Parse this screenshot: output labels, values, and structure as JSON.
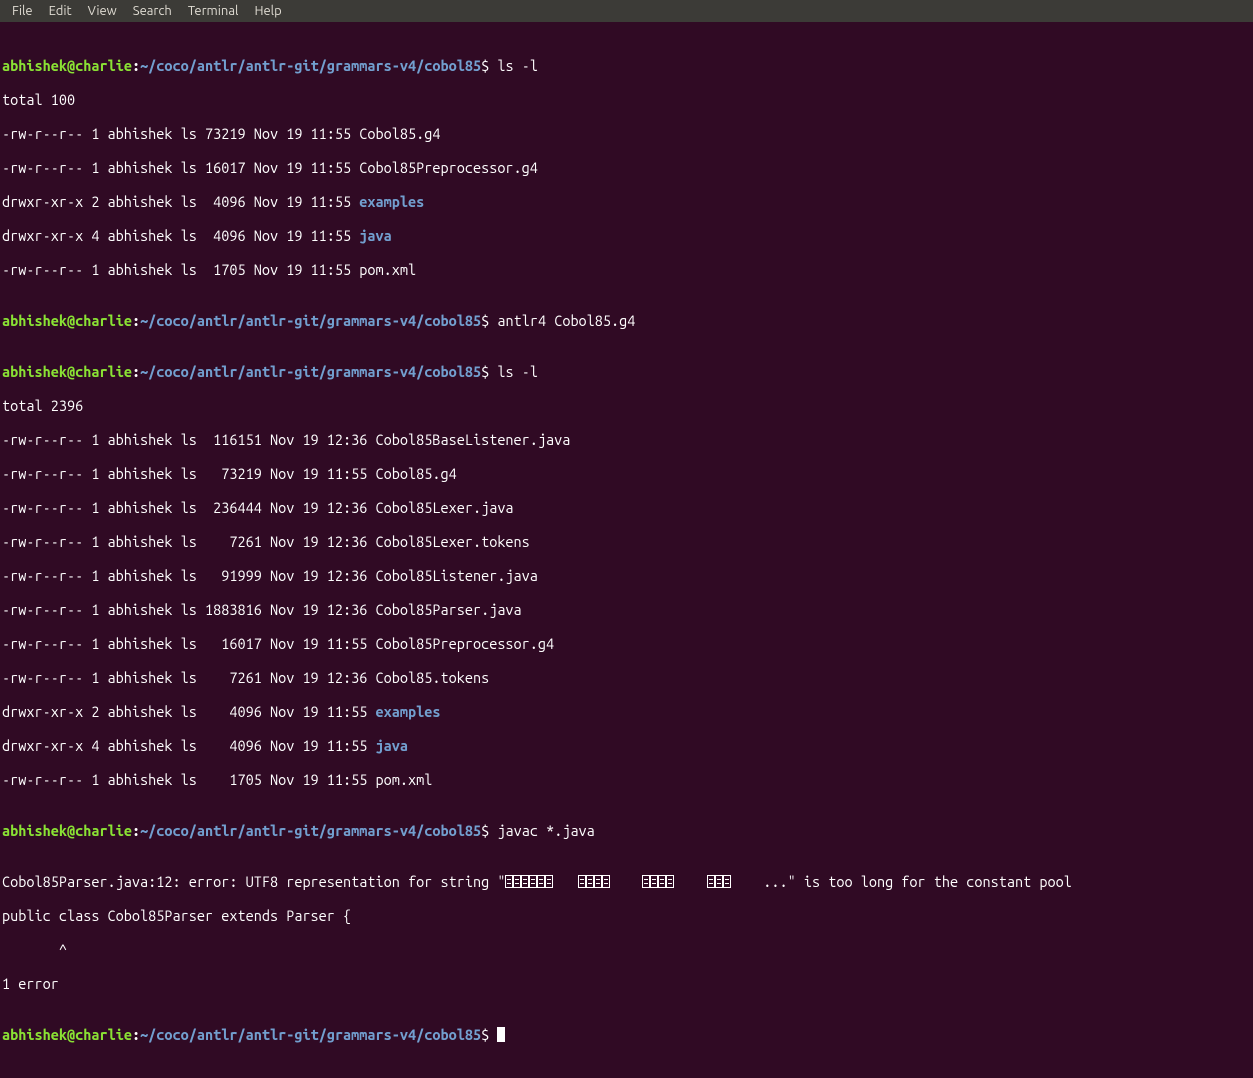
{
  "menu": {
    "file": "File",
    "edit": "Edit",
    "view": "View",
    "search": "Search",
    "terminal": "Terminal",
    "help": "Help"
  },
  "prompt": {
    "user": "abhishek",
    "at": "@",
    "host": "charlie",
    "colon": ":",
    "path": "~/coco/antlr/antlr-git/grammars-v4/cobol85",
    "dollar": "$"
  },
  "cmd1": "ls -l",
  "out1": {
    "total": "total 100",
    "l1": "-rw-r--r-- 1 abhishek ls 73219 Nov 19 11:55 Cobol85.g4",
    "l2": "-rw-r--r-- 1 abhishek ls 16017 Nov 19 11:55 Cobol85Preprocessor.g4",
    "l3a": "drwxr-xr-x 2 abhishek ls  4096 Nov 19 11:55 ",
    "l3b": "examples",
    "l4a": "drwxr-xr-x 4 abhishek ls  4096 Nov 19 11:55 ",
    "l4b": "java",
    "l5": "-rw-r--r-- 1 abhishek ls  1705 Nov 19 11:55 pom.xml"
  },
  "cmd2": "antlr4 Cobol85.g4",
  "cmd3": "ls -l",
  "out3": {
    "total": "total 2396",
    "l1": "-rw-r--r-- 1 abhishek ls  116151 Nov 19 12:36 Cobol85BaseListener.java",
    "l2": "-rw-r--r-- 1 abhishek ls   73219 Nov 19 11:55 Cobol85.g4",
    "l3": "-rw-r--r-- 1 abhishek ls  236444 Nov 19 12:36 Cobol85Lexer.java",
    "l4": "-rw-r--r-- 1 abhishek ls    7261 Nov 19 12:36 Cobol85Lexer.tokens",
    "l5": "-rw-r--r-- 1 abhishek ls   91999 Nov 19 12:36 Cobol85Listener.java",
    "l6": "-rw-r--r-- 1 abhishek ls 1883816 Nov 19 12:36 Cobol85Parser.java",
    "l7": "-rw-r--r-- 1 abhishek ls   16017 Nov 19 11:55 Cobol85Preprocessor.g4",
    "l8": "-rw-r--r-- 1 abhishek ls    7261 Nov 19 12:36 Cobol85.tokens",
    "l9a": "drwxr-xr-x 2 abhishek ls    4096 Nov 19 11:55 ",
    "l9b": "examples",
    "l10a": "drwxr-xr-x 4 abhishek ls    4096 Nov 19 11:55 ",
    "l10b": "java",
    "l11": "-rw-r--r-- 1 abhishek ls    1705 Nov 19 11:55 pom.xml"
  },
  "cmd4": "javac *.java",
  "err": {
    "l1a": "Cobol85Parser.java:12: error: UTF8 representation for string \"",
    "l1b": "...\" is too long for the constant pool",
    "l2": "public class Cobol85Parser extends Parser {",
    "l3": "       ^",
    "l4": "1 error"
  }
}
